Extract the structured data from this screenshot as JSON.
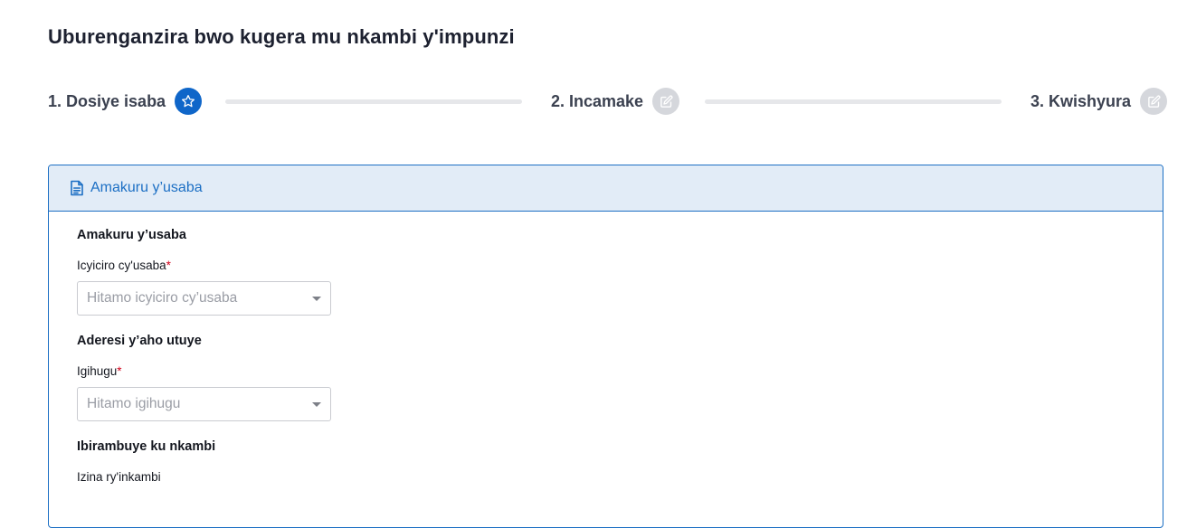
{
  "page": {
    "title": "Uburenganzira bwo kugera mu nkambi y'impunzi"
  },
  "stepper": {
    "steps": [
      {
        "label": "1. Dosiye isaba",
        "icon": "star-icon",
        "state": "active"
      },
      {
        "label": "2. Incamake",
        "icon": "edit-icon",
        "state": "inactive"
      },
      {
        "label": "3. Kwishyura",
        "icon": "edit-icon",
        "state": "inactive"
      }
    ]
  },
  "card": {
    "header_title": "Amakuru y’usaba",
    "header_icon": "document-icon",
    "sections": {
      "applicant": {
        "title": "Amakuru y’usaba",
        "category_label": "Icyiciro cy'usaba",
        "category_required": "*",
        "category_placeholder": "Hitamo icyiciro cy’usaba"
      },
      "address": {
        "title": "Aderesi y’aho utuye",
        "country_label": "Igihugu",
        "country_required": "*",
        "country_placeholder": "Hitamo igihugu"
      },
      "camp": {
        "title": "Ibirambuye ku nkambi",
        "camp_name_label": "Izina ry'inkambi"
      }
    }
  },
  "colors": {
    "accent": "#0f66c9",
    "card_border": "#1c6fc4",
    "card_header_bg": "#e2ecf7",
    "inactive_step": "#d5d7dc",
    "required": "#d0021b"
  }
}
